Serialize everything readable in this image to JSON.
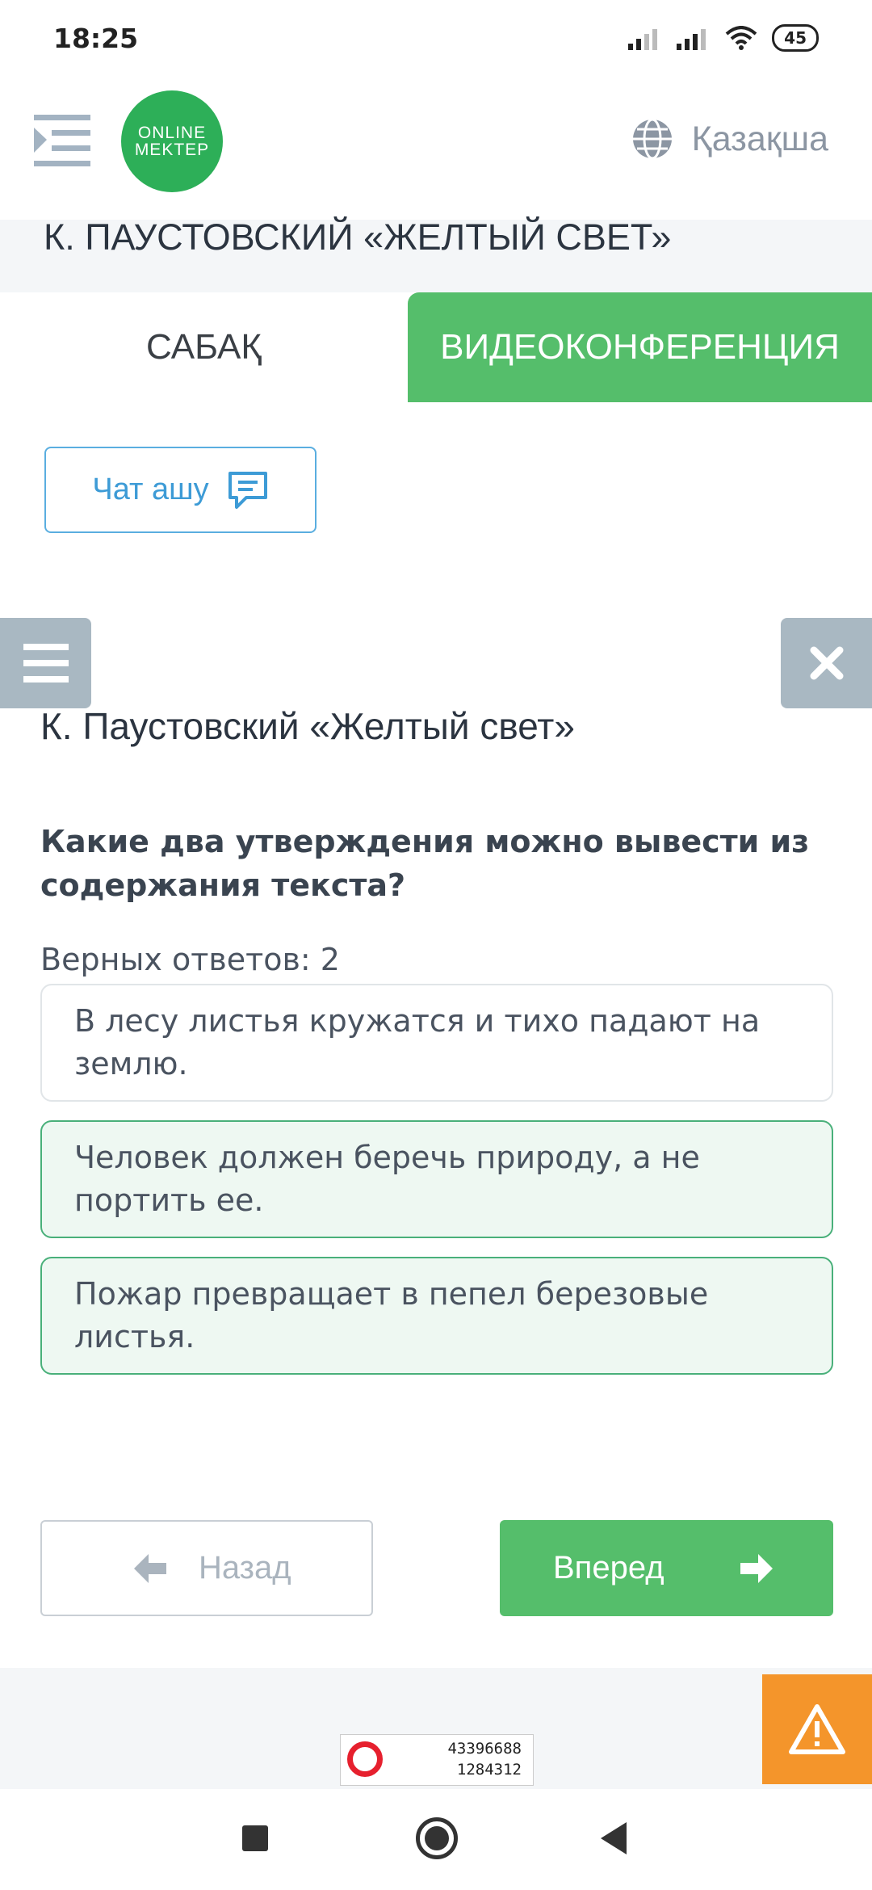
{
  "status_bar": {
    "time": "18:25",
    "battery": "45"
  },
  "header": {
    "logo_line1": "ONLINE",
    "logo_line2": "MEKTEP",
    "language": "Қазақша"
  },
  "lesson": {
    "title": "К. ПАУСТОВСКИЙ «ЖЕЛТЫЙ СВЕТ»",
    "tabs": [
      {
        "label": "САБАҚ",
        "active": false
      },
      {
        "label": "ВИДЕОКОНФЕРЕНЦИЯ",
        "active": true
      }
    ],
    "chat_button": "Чат ашу"
  },
  "quiz": {
    "title": "К. Паустовский «Желтый свет»",
    "question": "Какие два утверждения можно вывести из содержания текста?",
    "correct_answers": "Верных ответов: 2",
    "answers": [
      {
        "text": "В лесу листья кружатся и тихо падают на землю.",
        "selected": false
      },
      {
        "text": "Человек должен беречь природу, а не портить ее.",
        "selected": true
      },
      {
        "text": "Пожар превращает в пепел березовые листья.",
        "selected": true
      }
    ],
    "back_button": "Назад",
    "forward_button": "Вперед"
  },
  "footer": {
    "counter_line1": "43396688",
    "counter_line2": "1284312"
  },
  "colors": {
    "accent_green": "#55be6b",
    "selected_border": "#49b07a",
    "warning_orange": "#f4952b",
    "link_blue": "#3d9bd6"
  },
  "icons": [
    "menu-indent-icon",
    "globe-icon",
    "chat-icon",
    "hamburger-icon",
    "close-icon",
    "arrow-left-icon",
    "arrow-right-icon",
    "warning-icon"
  ]
}
